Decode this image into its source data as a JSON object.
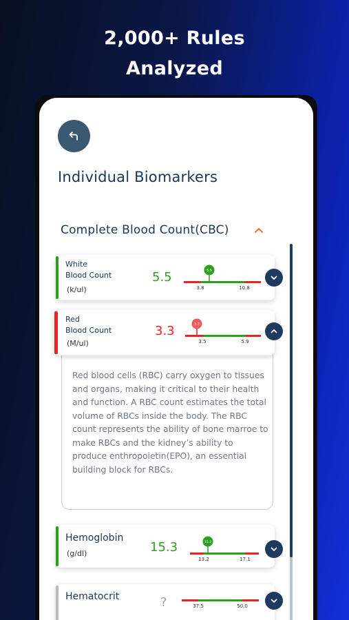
{
  "headline": {
    "line1": "2,000+ Rules",
    "line2": "Analyzed"
  },
  "page": {
    "title": "Individual Biomarkers"
  },
  "section": {
    "title": "Complete Blood Count(CBC)"
  },
  "colors": {
    "green": "#2f9e1f",
    "red": "#e32626",
    "navy": "#1f3a5f",
    "grey": "#b9b9b9"
  },
  "biomarkers": [
    {
      "name_line1": "White",
      "name_line2": "Blood Count",
      "unit": "(k/ul)",
      "value": "5.5",
      "status": "normal",
      "low": "3.8",
      "high": "10.8",
      "marker": "5.5"
    },
    {
      "name_line1": "Red",
      "name_line2": "Blood Count",
      "unit": "(M/ul)",
      "value": "3.3",
      "status": "low",
      "low": "3.5",
      "high": "5.9",
      "marker": "3.3",
      "description": "Red blood cells (RBC) carry oxygen to tissues and organs, making it critical to their health and function. A RBC count estimates the total volume of RBCs inside the body. The RBC count represents the ability of bone marroe to make RBCs and the kidney’s ability to produce enthropoietin(EPO), an essential building block for RBCs."
    },
    {
      "name": "Hemoglobin",
      "unit": "(g/dl)",
      "value": "15.3",
      "status": "normal",
      "low": "13.2",
      "high": "17.1",
      "marker": "15.3"
    },
    {
      "name": "Hematocrit",
      "value": "?",
      "status": "unknown",
      "low": "37.5",
      "high": "50.0"
    }
  ]
}
